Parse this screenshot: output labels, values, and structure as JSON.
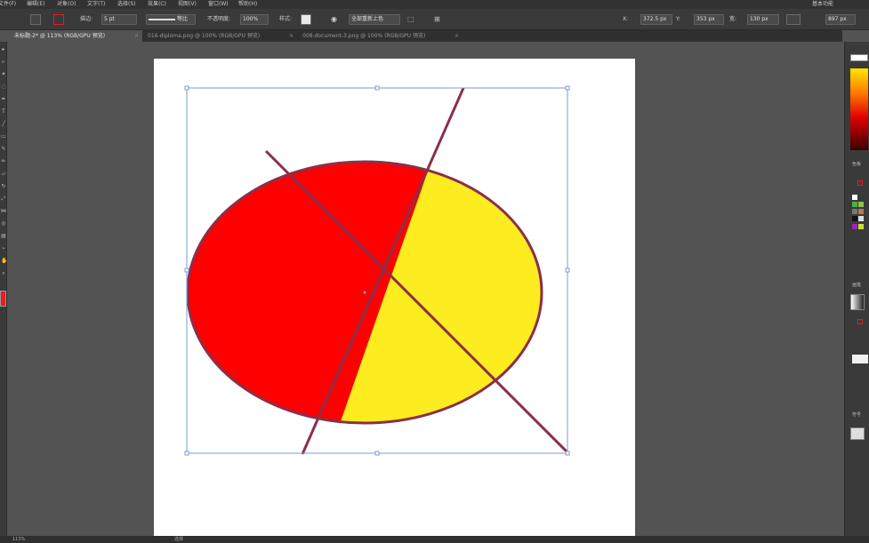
{
  "menubar": {
    "items": [
      "文件(F)",
      "编辑(E)",
      "对象(O)",
      "文字(T)",
      "选择(S)",
      "效果(C)",
      "视图(V)",
      "窗口(W)",
      "帮助(H)"
    ],
    "workspace": "基本功能"
  },
  "control": {
    "stroke_label": "描边:",
    "stroke_value": "5 pt",
    "profile_label": "等比",
    "opacity_label": "不透明度:",
    "opacity_value": "100%",
    "style_label": "样式:",
    "align_button": "全部重新上色",
    "x_value": "372.5 px",
    "y_value": "353 px",
    "w_label": "宽:",
    "w_value": "130 px",
    "h_value": "897 px"
  },
  "tabs": [
    {
      "label": "未标题-2* @ 113% (RGB/GPU 预览)",
      "close": "×"
    },
    {
      "label": "016-diploma.png @ 100% (RGB/GPU 预览)",
      "close": "×"
    },
    {
      "label": "008-document-3.png @ 100% (RGB/GPU 预览)",
      "close": "×"
    }
  ],
  "panels": {
    "swatches_title": "色板",
    "brushes_title": "画笔",
    "symbols_title": "符号"
  },
  "status": {
    "zoom": "113%",
    "mode": "选择"
  },
  "colors": {
    "red": "#ff0000",
    "yellow": "#fdec1f",
    "stroke": "#8b2f4a",
    "bbox": "#7e9bd6"
  }
}
